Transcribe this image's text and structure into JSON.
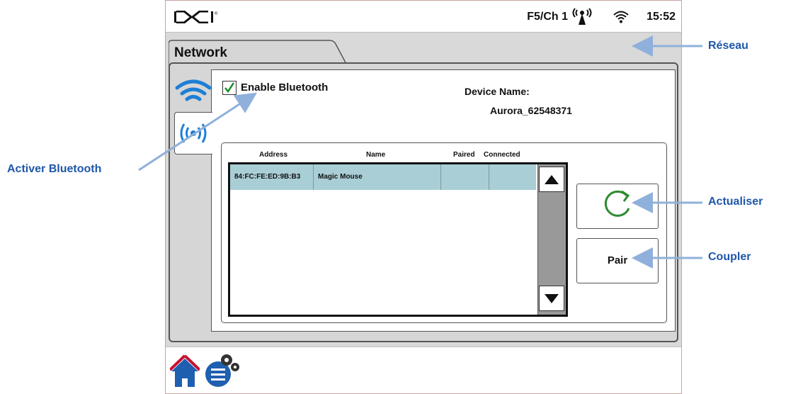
{
  "status_bar": {
    "brand": "DCI",
    "channel": "F5/Ch 1",
    "time": "15:52"
  },
  "tab": {
    "label": "Network"
  },
  "bluetooth": {
    "enable_label": "Enable Bluetooth",
    "enabled": true,
    "device_name_label": "Device Name:",
    "device_name_value": "Aurora_62548371"
  },
  "device_list": {
    "columns": [
      "Address",
      "Name",
      "Paired",
      "Connected"
    ],
    "rows": [
      {
        "address": "84:FC:FE:ED:9B:B3",
        "name": "Magic Mouse",
        "paired": "",
        "connected": ""
      }
    ]
  },
  "buttons": {
    "refresh_icon": "refresh-icon",
    "pair_label": "Pair"
  },
  "callouts": {
    "network": "Réseau",
    "enable_bluetooth": "Activer Bluetooth",
    "refresh": "Actualiser",
    "pair": "Coupler"
  },
  "colors": {
    "accent": "#1f57a8",
    "row_highlight": "#a9ced6",
    "wifi_blue": "#1e7fd6",
    "check_green": "#1a8f2a",
    "refresh_green": "#2e8b2e"
  }
}
